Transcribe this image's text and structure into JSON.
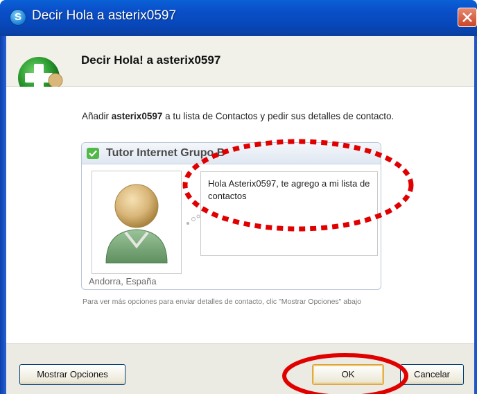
{
  "window": {
    "title": "Decir Hola a asterix0597",
    "close_icon": "close-icon"
  },
  "header": {
    "title": "Decir Hola! a asterix0597",
    "icon": "add-contact-icon"
  },
  "intro": {
    "prefix": "Añadir ",
    "username": "asterix0597",
    "suffix": " a tu lista de Contactos y pedir sus detalles de contacto."
  },
  "card": {
    "group_name": "Tutor Internet Grupo B",
    "group_icon": "skype-status-icon",
    "avatar_icon": "default-avatar-icon",
    "location": "Andorra, España",
    "message": "Hola Asterix0597, te agrego a mi lista de contactos"
  },
  "help_text": "Para ver más opciones para enviar detalles de contacto, clic \"Mostrar Opciones\" abajo",
  "buttons": {
    "more_options": "Mostrar Opciones",
    "ok": "OK",
    "cancel": "Cancelar"
  },
  "colors": {
    "titlebar": "#0a4fc9",
    "annotation_red": "#e00000"
  }
}
